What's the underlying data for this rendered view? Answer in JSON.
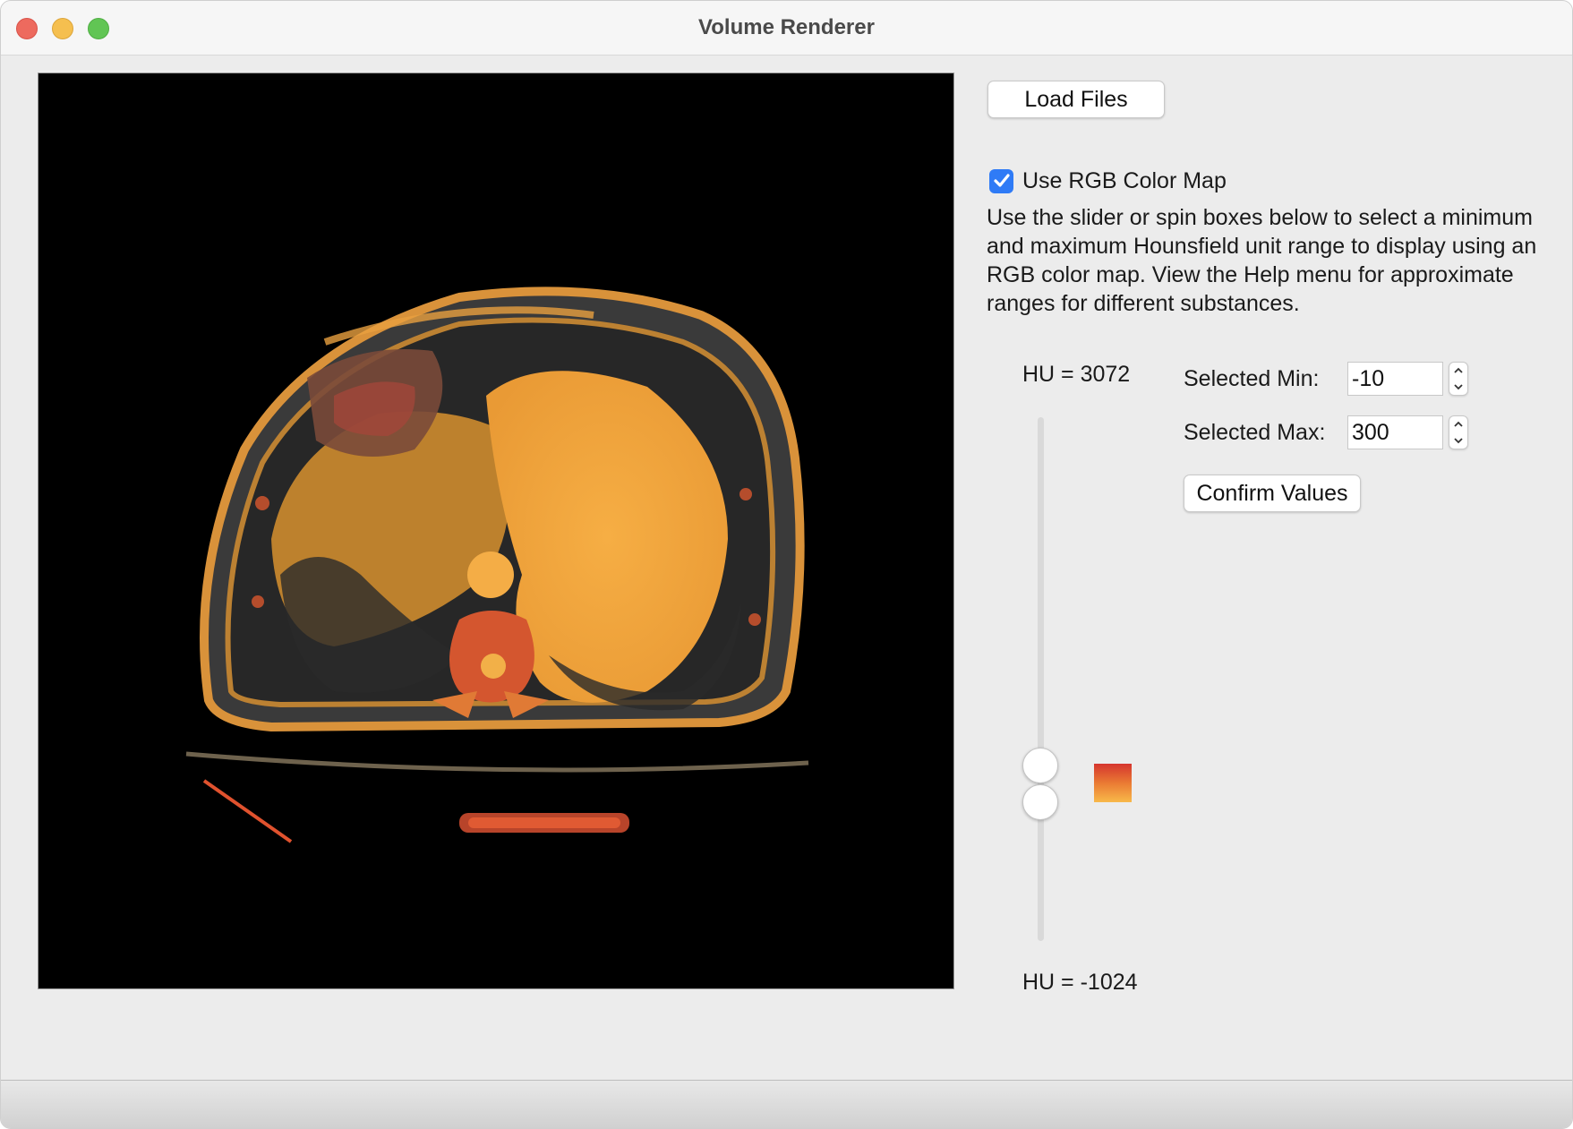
{
  "window": {
    "title": "Volume Renderer"
  },
  "controls": {
    "load_label": "Load Files",
    "rgb_checkbox_label": "Use RGB Color Map",
    "rgb_checked": true,
    "description": "Use the slider or spin boxes below to select a minimum and maximum Hounsfield unit range to display using an RGB color map. View the Help menu for approximate ranges for different substances.",
    "hu_max_label": "HU = 3072",
    "hu_min_label": "HU = -1024",
    "selected_min_label": "Selected Min:",
    "selected_min_value": "-10",
    "selected_max_label": "Selected Max:",
    "selected_max_value": "300",
    "confirm_label": "Confirm Values"
  },
  "colors": {
    "orange": "#f4a43a",
    "red": "#d5352e",
    "background": "#ececec",
    "checkbox_blue": "#2f7bf6"
  }
}
